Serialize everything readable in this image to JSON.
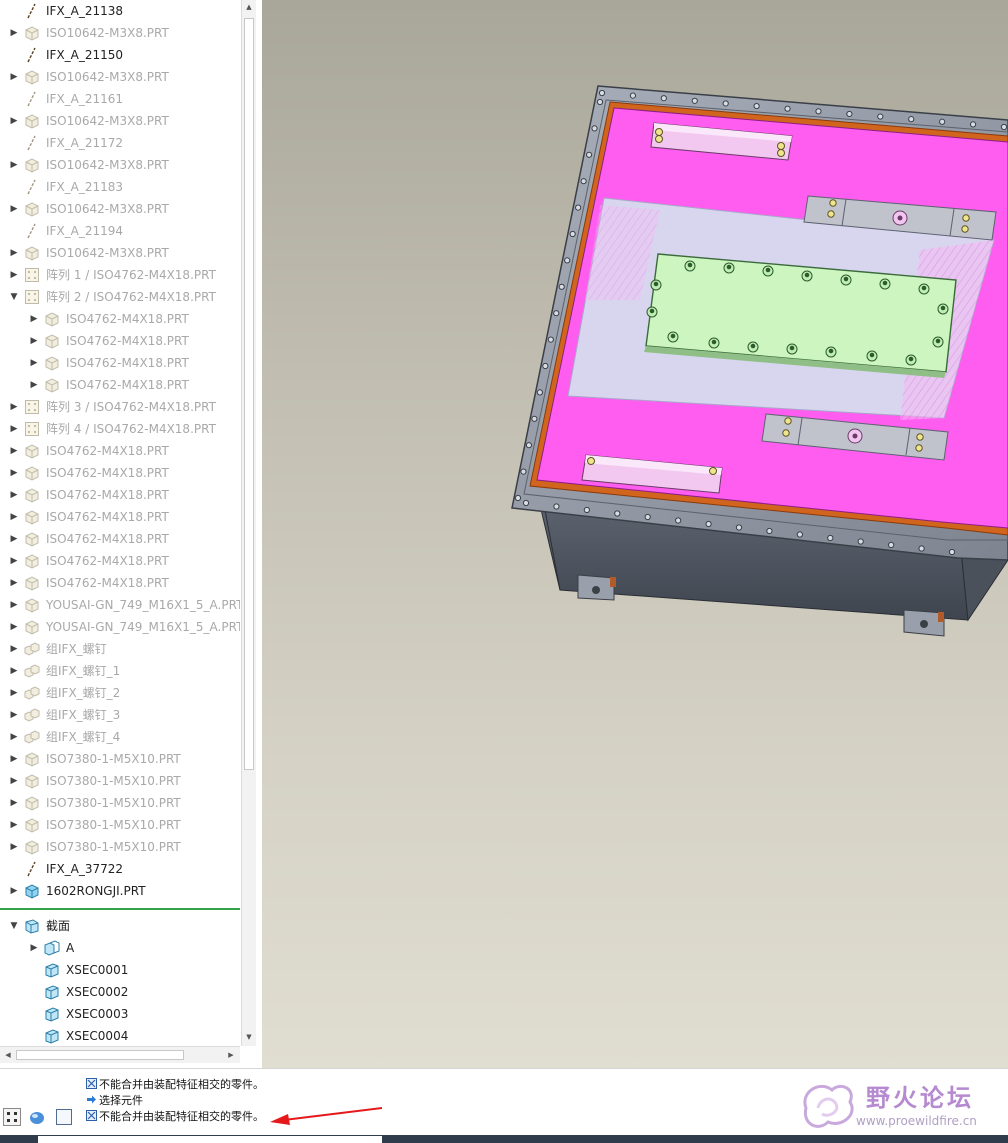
{
  "tree": {
    "items": [
      {
        "label": "IFX_A_21138",
        "icon": "datum-curve-icon",
        "arrow": false,
        "dim": false,
        "indent": 0
      },
      {
        "label": "ISO10642-M3X8.PRT",
        "icon": "part-icon",
        "arrow": true,
        "dim": true,
        "indent": 0
      },
      {
        "label": "IFX_A_21150",
        "icon": "datum-curve-icon",
        "arrow": false,
        "dim": false,
        "indent": 0
      },
      {
        "label": "ISO10642-M3X8.PRT",
        "icon": "part-icon",
        "arrow": true,
        "dim": true,
        "indent": 0
      },
      {
        "label": "IFX_A_21161",
        "icon": "datum-curve-icon",
        "arrow": false,
        "dim": true,
        "indent": 0
      },
      {
        "label": "ISO10642-M3X8.PRT",
        "icon": "part-icon",
        "arrow": true,
        "dim": true,
        "indent": 0
      },
      {
        "label": "IFX_A_21172",
        "icon": "datum-curve-icon",
        "arrow": false,
        "dim": true,
        "indent": 0
      },
      {
        "label": "ISO10642-M3X8.PRT",
        "icon": "part-icon",
        "arrow": true,
        "dim": true,
        "indent": 0
      },
      {
        "label": "IFX_A_21183",
        "icon": "datum-curve-icon",
        "arrow": false,
        "dim": true,
        "indent": 0
      },
      {
        "label": "ISO10642-M3X8.PRT",
        "icon": "part-icon",
        "arrow": true,
        "dim": true,
        "indent": 0
      },
      {
        "label": "IFX_A_21194",
        "icon": "datum-curve-icon",
        "arrow": false,
        "dim": true,
        "indent": 0
      },
      {
        "label": "ISO10642-M3X8.PRT",
        "icon": "part-icon",
        "arrow": true,
        "dim": true,
        "indent": 0
      },
      {
        "label": "阵列 1 / ISO4762-M4X18.PRT",
        "icon": "pattern-icon",
        "arrow": true,
        "dim": true,
        "indent": 0
      },
      {
        "label": "阵列 2 / ISO4762-M4X18.PRT",
        "icon": "pattern-icon",
        "arrow": "open",
        "dim": true,
        "indent": 0
      },
      {
        "label": "ISO4762-M4X18.PRT",
        "icon": "part-icon",
        "arrow": true,
        "dim": true,
        "indent": 1
      },
      {
        "label": "ISO4762-M4X18.PRT",
        "icon": "part-icon",
        "arrow": true,
        "dim": true,
        "indent": 1
      },
      {
        "label": "ISO4762-M4X18.PRT",
        "icon": "part-icon",
        "arrow": true,
        "dim": true,
        "indent": 1
      },
      {
        "label": "ISO4762-M4X18.PRT",
        "icon": "part-icon",
        "arrow": true,
        "dim": true,
        "indent": 1
      },
      {
        "label": "阵列 3 / ISO4762-M4X18.PRT",
        "icon": "pattern-icon",
        "arrow": true,
        "dim": true,
        "indent": 0
      },
      {
        "label": "阵列 4 / ISO4762-M4X18.PRT",
        "icon": "pattern-icon",
        "arrow": true,
        "dim": true,
        "indent": 0
      },
      {
        "label": "ISO4762-M4X18.PRT",
        "icon": "part-icon",
        "arrow": true,
        "dim": true,
        "indent": 0
      },
      {
        "label": "ISO4762-M4X18.PRT",
        "icon": "part-icon",
        "arrow": true,
        "dim": true,
        "indent": 0
      },
      {
        "label": "ISO4762-M4X18.PRT",
        "icon": "part-icon",
        "arrow": true,
        "dim": true,
        "indent": 0
      },
      {
        "label": "ISO4762-M4X18.PRT",
        "icon": "part-icon",
        "arrow": true,
        "dim": true,
        "indent": 0
      },
      {
        "label": "ISO4762-M4X18.PRT",
        "icon": "part-icon",
        "arrow": true,
        "dim": true,
        "indent": 0
      },
      {
        "label": "ISO4762-M4X18.PRT",
        "icon": "part-icon",
        "arrow": true,
        "dim": true,
        "indent": 0
      },
      {
        "label": "ISO4762-M4X18.PRT",
        "icon": "part-icon",
        "arrow": true,
        "dim": true,
        "indent": 0
      },
      {
        "label": "YOUSAI-GN_749_M16X1_5_A.PRT",
        "icon": "part-icon",
        "arrow": true,
        "dim": true,
        "indent": 0
      },
      {
        "label": "YOUSAI-GN_749_M16X1_5_A.PRT",
        "icon": "part-icon",
        "arrow": true,
        "dim": true,
        "indent": 0
      },
      {
        "label": "组IFX_螺钉",
        "icon": "group-icon",
        "arrow": true,
        "dim": true,
        "indent": 0
      },
      {
        "label": "组IFX_螺钉_1",
        "icon": "group-icon",
        "arrow": true,
        "dim": true,
        "indent": 0
      },
      {
        "label": "组IFX_螺钉_2",
        "icon": "group-icon",
        "arrow": true,
        "dim": true,
        "indent": 0
      },
      {
        "label": "组IFX_螺钉_3",
        "icon": "group-icon",
        "arrow": true,
        "dim": true,
        "indent": 0
      },
      {
        "label": "组IFX_螺钉_4",
        "icon": "group-icon",
        "arrow": true,
        "dim": true,
        "indent": 0
      },
      {
        "label": "ISO7380-1-M5X10.PRT",
        "icon": "part-icon",
        "arrow": true,
        "dim": true,
        "indent": 0
      },
      {
        "label": "ISO7380-1-M5X10.PRT",
        "icon": "part-icon",
        "arrow": true,
        "dim": true,
        "indent": 0
      },
      {
        "label": "ISO7380-1-M5X10.PRT",
        "icon": "part-icon",
        "arrow": true,
        "dim": true,
        "indent": 0
      },
      {
        "label": "ISO7380-1-M5X10.PRT",
        "icon": "part-icon",
        "arrow": true,
        "dim": true,
        "indent": 0
      },
      {
        "label": "ISO7380-1-M5X10.PRT",
        "icon": "part-icon",
        "arrow": true,
        "dim": true,
        "indent": 0
      },
      {
        "label": "IFX_A_37722",
        "icon": "datum-curve-icon",
        "arrow": false,
        "dim": false,
        "indent": 0
      },
      {
        "label": "1602RONGJI.PRT",
        "icon": "part-blue-icon",
        "arrow": true,
        "dim": false,
        "indent": 0
      }
    ],
    "sections": {
      "header": {
        "label": "截面",
        "icon": "section-folder-icon"
      },
      "items": [
        {
          "label": "A",
          "icon": "section-group-icon",
          "arrow": true
        },
        {
          "label": "XSEC0001",
          "icon": "section-icon",
          "arrow": false
        },
        {
          "label": "XSEC0002",
          "icon": "section-icon",
          "arrow": false
        },
        {
          "label": "XSEC0003",
          "icon": "section-icon",
          "arrow": false
        },
        {
          "label": "XSEC0004",
          "icon": "section-icon",
          "arrow": false
        }
      ]
    }
  },
  "messages": [
    {
      "text": "不能合并由装配特征相交的零件。",
      "icon": "warning-icon"
    },
    {
      "text": "选择元件",
      "icon": "arrow-right-icon"
    },
    {
      "text": "不能合并由装配特征相交的零件。",
      "icon": "warning-icon"
    }
  ],
  "watermark": {
    "title": "野火论坛",
    "url": "www.proewildfire.cn"
  },
  "colors": {
    "pink": "#ff5cf0",
    "lavender": "#d8d6ef",
    "green_plate": "#ccf5c0",
    "steel": "#8d939e",
    "accent_arrow": "#e5191b"
  }
}
